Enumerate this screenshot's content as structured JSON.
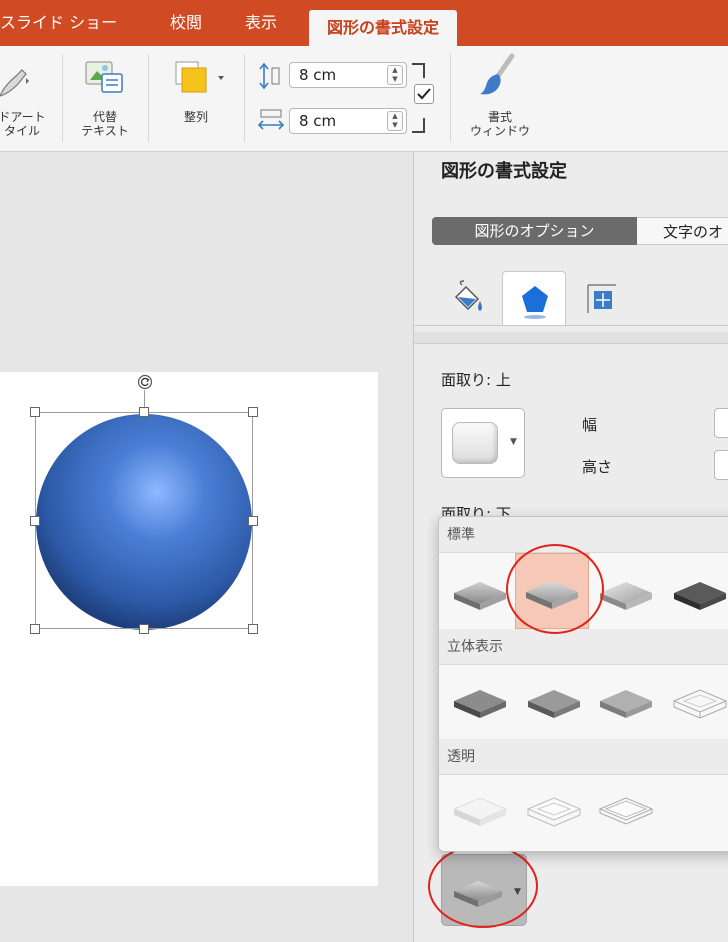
{
  "tabs": [
    {
      "label": "スライド ショー",
      "active": false
    },
    {
      "label": "校閲",
      "active": false
    },
    {
      "label": "表示",
      "active": false
    },
    {
      "label": "図形の書式設定",
      "active": true
    }
  ],
  "ribbon": {
    "wordart_label_line1": "ドアート",
    "wordart_label_line2": "タイル",
    "alt_text_line1": "代替",
    "alt_text_line2": "テキスト",
    "arrange_label": "整列",
    "height_value": "8 cm",
    "width_value": "8 cm",
    "lock_aspect_checked": true,
    "format_pane_line1": "書式",
    "format_pane_line2": "ウィンドウ"
  },
  "pane": {
    "title": "図形の書式設定",
    "seg_options_label": "図形のオプション",
    "seg_text_label": "文字のオ",
    "active_icon_tab": "effects",
    "bevel_top_label": "面取り: 上",
    "width_label": "幅",
    "height_label": "高さ",
    "bevel_bottom_label": "面取り: 下"
  },
  "gallery": {
    "sections": [
      {
        "title": "標準",
        "items": [
          "circle-bevel",
          "relaxed-inset",
          "cross",
          "cool-slant"
        ],
        "selected_index": 1
      },
      {
        "title": "立体表示",
        "items": [
          "angle",
          "soft-round",
          "convex",
          "wire-frame"
        ]
      },
      {
        "title": "透明",
        "items": [
          "transparent-1",
          "transparent-2",
          "transparent-3"
        ]
      }
    ]
  },
  "colors": {
    "accent": "#d04a24",
    "active_tab_text": "#c8401c",
    "selection": "#f5c8b8",
    "annotation_circle": "#e0241a",
    "sphere": "#3a6ec4"
  }
}
